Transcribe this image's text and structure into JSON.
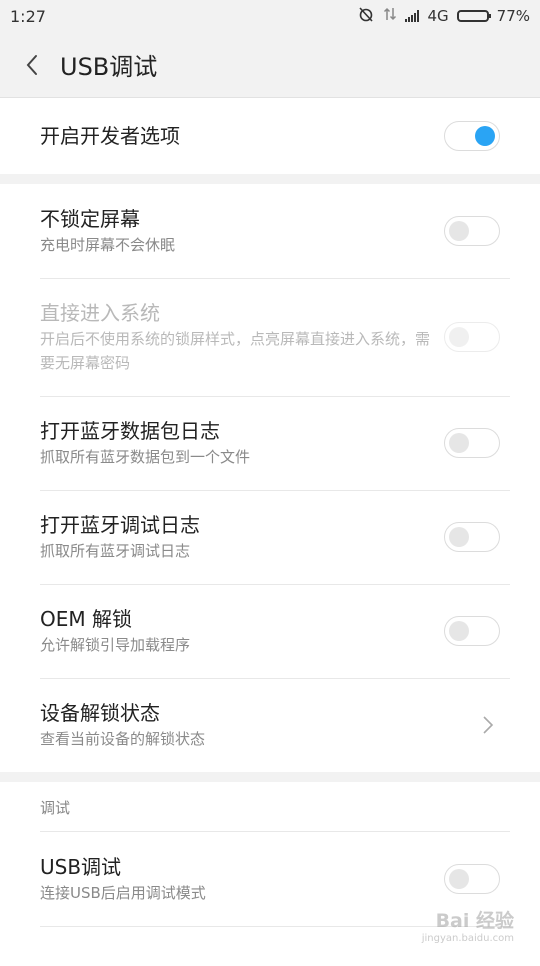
{
  "status": {
    "time": "1:27",
    "network": "4G",
    "battery": "77%",
    "battery_level": 0.77
  },
  "header": {
    "title": "USB调试"
  },
  "developer": {
    "title": "开启开发者选项",
    "enabled": true
  },
  "settings": [
    {
      "title": "不锁定屏幕",
      "subtitle": "充电时屏幕不会休眠",
      "control": "toggle",
      "on": false,
      "disabled": false
    },
    {
      "title": "直接进入系统",
      "subtitle": "开启后不使用系统的锁屏样式，点亮屏幕直接进入系统，需要无屏幕密码",
      "control": "toggle",
      "on": false,
      "disabled": true
    },
    {
      "title": "打开蓝牙数据包日志",
      "subtitle": "抓取所有蓝牙数据包到一个文件",
      "control": "toggle",
      "on": false,
      "disabled": false
    },
    {
      "title": "打开蓝牙调试日志",
      "subtitle": "抓取所有蓝牙调试日志",
      "control": "toggle",
      "on": false,
      "disabled": false
    },
    {
      "title": "OEM 解锁",
      "subtitle": "允许解锁引导加载程序",
      "control": "toggle",
      "on": false,
      "disabled": false
    },
    {
      "title": "设备解锁状态",
      "subtitle": "查看当前设备的解锁状态",
      "control": "chevron",
      "disabled": false
    }
  ],
  "debug_section": {
    "header": "调试",
    "items": [
      {
        "title": "USB调试",
        "subtitle": "连接USB后启用调试模式",
        "on": false
      }
    ]
  },
  "watermark": {
    "text": "Bai 经验",
    "sub": "jingyan.baidu.com"
  }
}
